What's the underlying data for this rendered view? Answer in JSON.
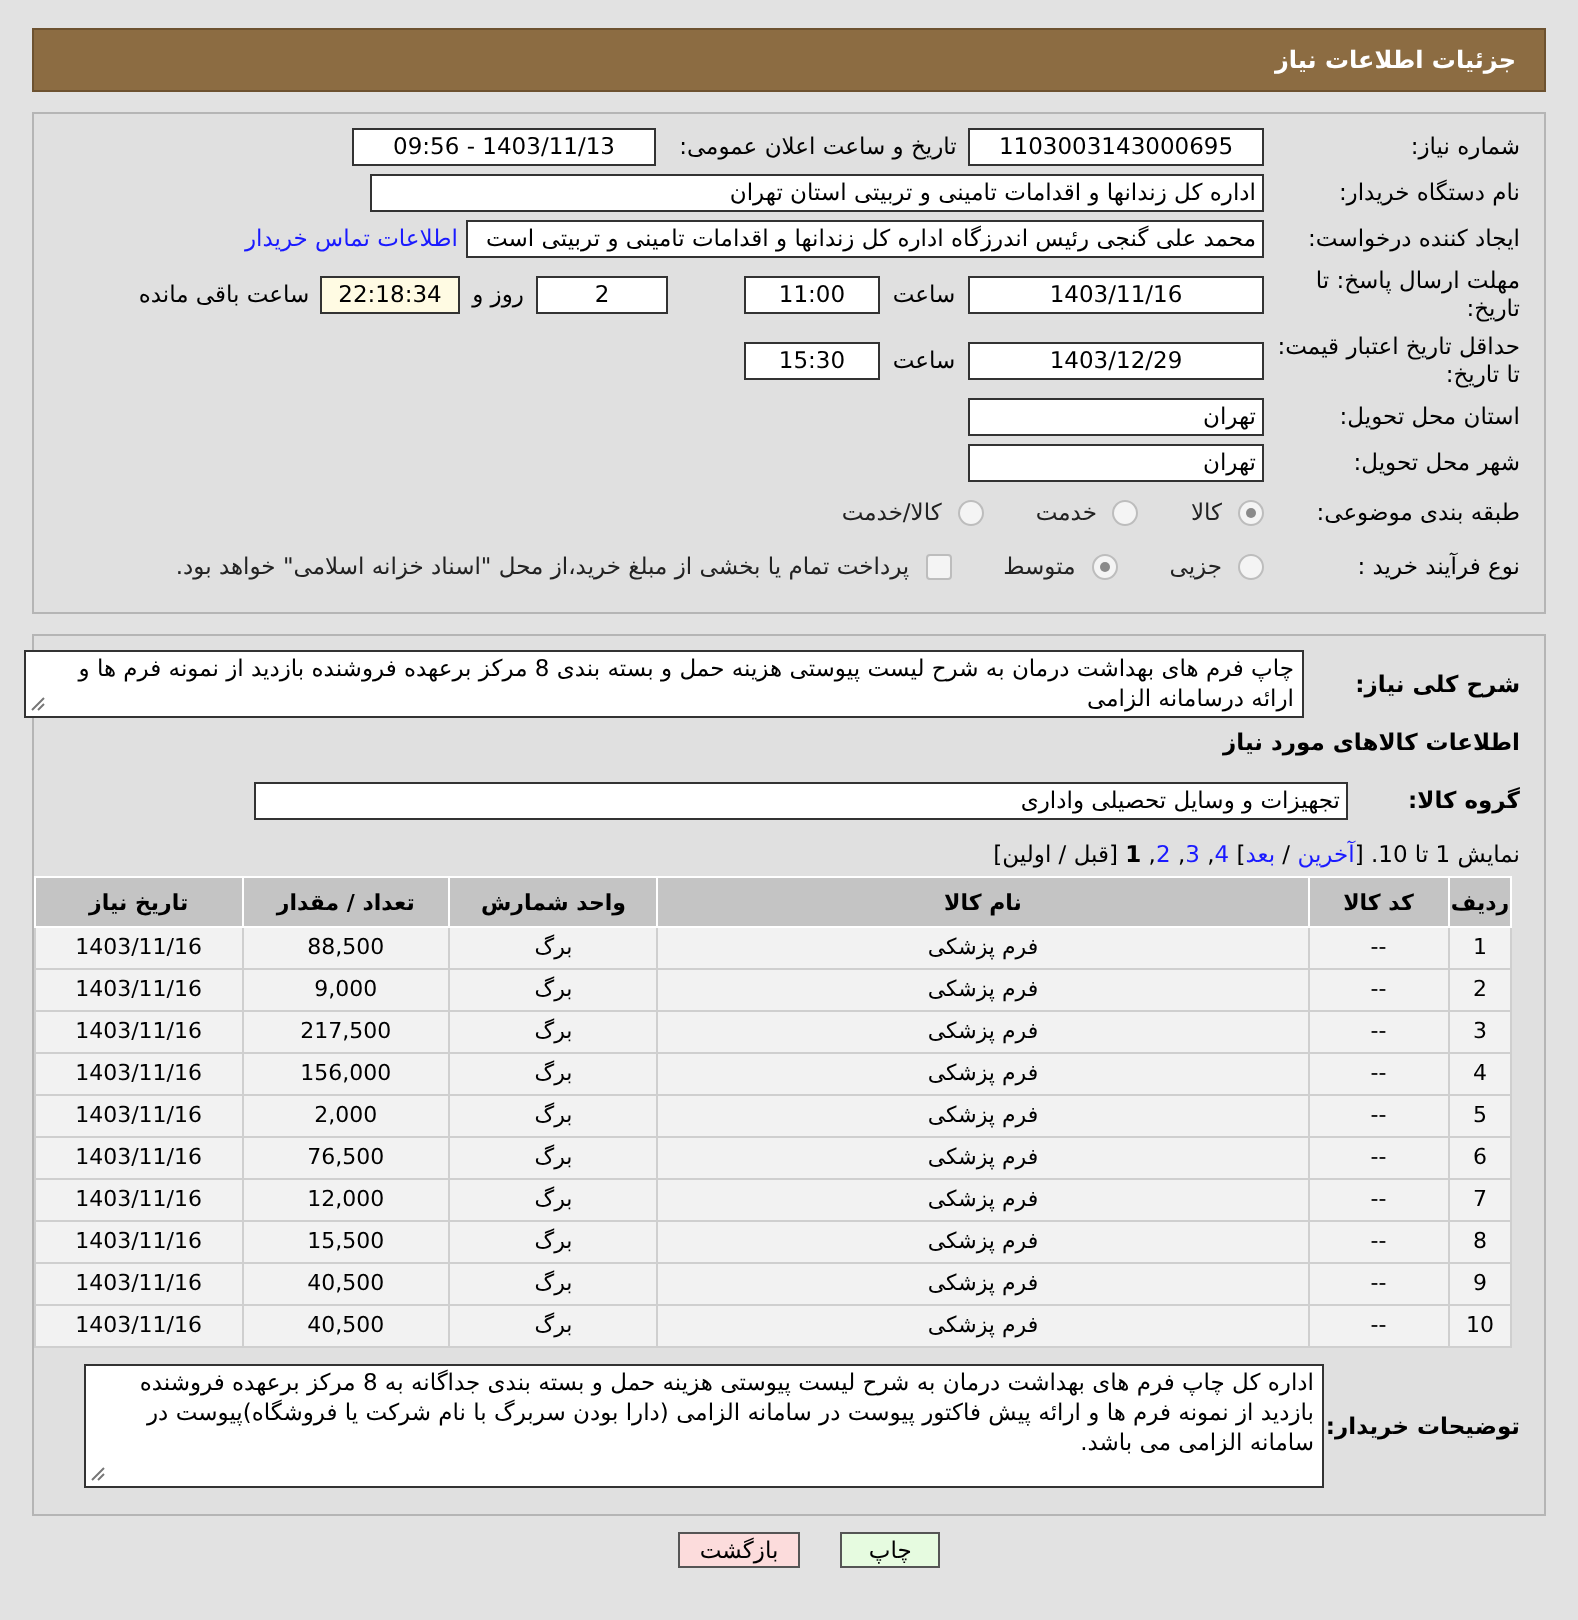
{
  "header": {
    "title": "جزئیات اطلاعات نیاز"
  },
  "need_number": {
    "label": "شماره نیاز:",
    "value": "1103003143000695"
  },
  "announce": {
    "label": "تاریخ و ساعت اعلان عمومی:",
    "value": "1403/11/13 - 09:56"
  },
  "buyer": {
    "label": "نام دستگاه خریدار:",
    "value": "اداره کل زندانها و اقدامات تامینی و تربیتی استان تهران"
  },
  "requester": {
    "label": "ایجاد کننده درخواست:",
    "value": "محمد علی گنجی رئیس اندرزگاه  اداره کل زندانها و اقدامات تامینی و تربیتی است",
    "link": "اطلاعات تماس خریدار"
  },
  "deadline": {
    "label": "مهلت ارسال پاسخ: تا تاریخ:",
    "date": "1403/11/16",
    "time_label": "ساعت",
    "time": "11:00",
    "days": "2",
    "days_label": "روز و",
    "remaining": "22:18:34",
    "remaining_label": "ساعت باقی مانده"
  },
  "validity": {
    "label": "حداقل تاریخ اعتبار قیمت: تا تاریخ:",
    "date": "1403/12/29",
    "time_label": "ساعت",
    "time": "15:30"
  },
  "province": {
    "label": "استان محل تحویل:",
    "value": "تهران"
  },
  "city": {
    "label": "شهر محل تحویل:",
    "value": "تهران"
  },
  "category": {
    "label": "طبقه بندی موضوعی:",
    "options": [
      {
        "label": "کالا",
        "selected": true
      },
      {
        "label": "خدمت",
        "selected": false
      },
      {
        "label": "کالا/خدمت",
        "selected": false
      }
    ]
  },
  "process": {
    "label": "نوع فرآیند خرید :",
    "options": [
      {
        "label": "جزیی",
        "selected": false
      },
      {
        "label": "متوسط",
        "selected": true
      }
    ],
    "payment": {
      "label": "پرداخت تمام یا بخشی از مبلغ خرید،از محل \"اسناد خزانه اسلامی\" خواهد بود.",
      "checked": false
    }
  },
  "summary": {
    "label": "شرح کلی نیاز:",
    "value": "چاپ فرم های بهداشت درمان به شرح لیست پیوستی هزینه حمل و بسته بندی 8 مرکز برعهده فروشنده بازدید از نمونه فرم ها و ارائه  درسامانه الزامی"
  },
  "goods_title": "اطلاعات کالاهای مورد نیاز",
  "goods_group": {
    "label": "گروه کالا:",
    "value": "تجهیزات و وسایل تحصیلی واداری"
  },
  "pagination": [
    {
      "kind": "text",
      "text": "نمایش 1 تا 10. ["
    },
    {
      "kind": "link",
      "text": "آخرین"
    },
    {
      "kind": "text",
      "text": " / "
    },
    {
      "kind": "link",
      "text": "بعد"
    },
    {
      "kind": "text",
      "text": "] "
    },
    {
      "kind": "link",
      "text": "4"
    },
    {
      "kind": "text",
      "text": ", "
    },
    {
      "kind": "link",
      "text": "3"
    },
    {
      "kind": "text",
      "text": ", "
    },
    {
      "kind": "link",
      "text": "2"
    },
    {
      "kind": "text",
      "text": ", "
    },
    {
      "kind": "current",
      "text": "1"
    },
    {
      "kind": "text",
      "text": " [قبل / اولین]"
    }
  ],
  "table": {
    "columns": [
      "ردیف",
      "کد کالا",
      "نام کالا",
      "واحد شمارش",
      "تعداد / مقدار",
      "تاریخ نیاز"
    ],
    "rows": [
      [
        "1",
        "--",
        "فرم پزشکی",
        "برگ",
        "88,500",
        "1403/11/16"
      ],
      [
        "2",
        "--",
        "فرم پزشکی",
        "برگ",
        "9,000",
        "1403/11/16"
      ],
      [
        "3",
        "--",
        "فرم پزشکی",
        "برگ",
        "217,500",
        "1403/11/16"
      ],
      [
        "4",
        "--",
        "فرم پزشکی",
        "برگ",
        "156,000",
        "1403/11/16"
      ],
      [
        "5",
        "--",
        "فرم پزشکی",
        "برگ",
        "2,000",
        "1403/11/16"
      ],
      [
        "6",
        "--",
        "فرم پزشکی",
        "برگ",
        "76,500",
        "1403/11/16"
      ],
      [
        "7",
        "--",
        "فرم پزشکی",
        "برگ",
        "12,000",
        "1403/11/16"
      ],
      [
        "8",
        "--",
        "فرم پزشکی",
        "برگ",
        "15,500",
        "1403/11/16"
      ],
      [
        "9",
        "--",
        "فرم پزشکی",
        "برگ",
        "40,500",
        "1403/11/16"
      ],
      [
        "10",
        "--",
        "فرم پزشکی",
        "برگ",
        "40,500",
        "1403/11/16"
      ]
    ]
  },
  "buyer_notes": {
    "label": "توضیحات خریدار:",
    "value": "اداره کل چاپ فرم های بهداشت درمان به شرح لیست پیوستی هزینه حمل و بسته بندی جداگانه به 8 مرکز برعهده فروشنده بازدید از نمونه فرم ها و ارائه پیش فاکتور پیوست در سامانه الزامی (دارا بودن سربرگ با نام شرکت یا فروشگاه)پیوست در سامانه الزامی می باشد."
  },
  "buttons": [
    {
      "label": "چاپ",
      "kind": "print"
    },
    {
      "label": "بازگشت",
      "kind": "back"
    }
  ]
}
